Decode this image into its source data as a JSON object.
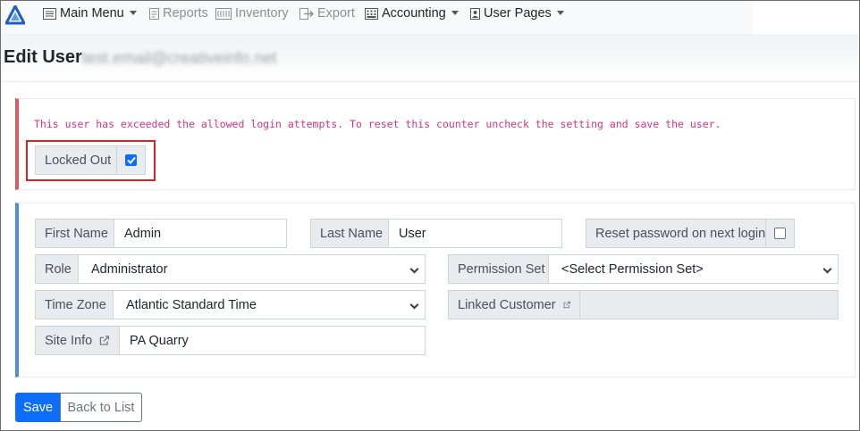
{
  "nav": {
    "main_menu": "Main Menu",
    "reports": "Reports",
    "inventory": "Inventory",
    "export": "Export",
    "accounting": "Accounting",
    "user_pages": "User Pages"
  },
  "header": {
    "title": "Edit User",
    "email": "test.email@creativeinfo.net"
  },
  "lockout": {
    "message": "This user has exceeded the allowed login attempts. To reset this counter uncheck the setting and save the user.",
    "label": "Locked Out",
    "checked": true
  },
  "form": {
    "first_name_label": "First Name",
    "first_name_value": "Admin",
    "last_name_label": "Last Name",
    "last_name_value": "User",
    "reset_password_label": "Reset password on next login",
    "reset_password_checked": false,
    "role_label": "Role",
    "role_value": "Administrator",
    "permission_set_label": "Permission Set",
    "permission_set_value": "<Select Permission Set>",
    "time_zone_label": "Time Zone",
    "time_zone_value": "Atlantic Standard Time",
    "linked_customer_label": "Linked Customer",
    "linked_customer_value": "",
    "site_info_label": "Site Info",
    "site_info_value": "PA Quarry"
  },
  "actions": {
    "save": "Save",
    "back": "Back to List"
  },
  "colors": {
    "primary": "#0d6efd",
    "warning_border": "#dc5c5c",
    "info_border": "#4a90d9",
    "warning_text": "#d63384",
    "highlight": "#e02020"
  }
}
